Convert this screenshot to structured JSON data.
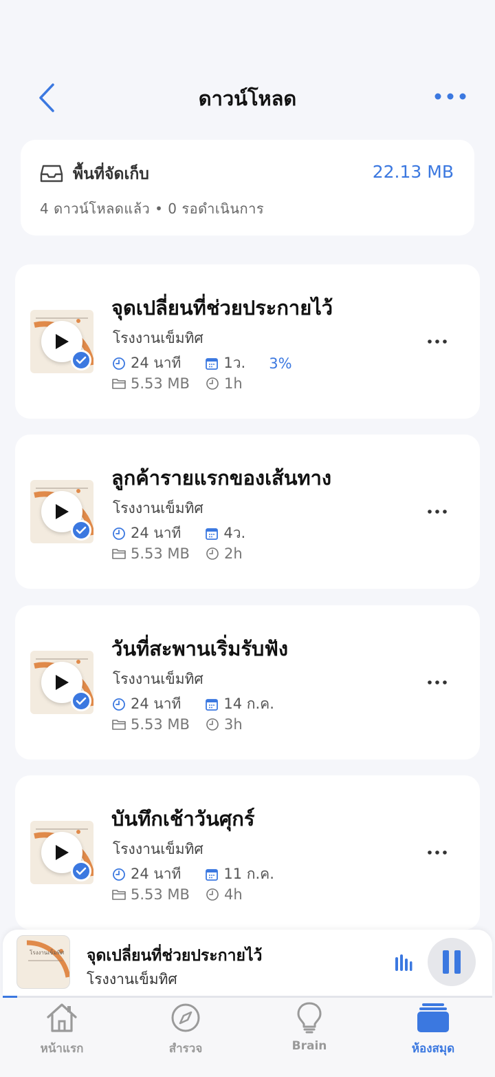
{
  "header": {
    "title": "ดาวน์โหลด"
  },
  "storage": {
    "title": "พื้นที่จัดเก็บ",
    "size": "22.13 MB",
    "summary": "4 ดาวน์โหลดแล้ว • 0 รอดำเนินการ"
  },
  "episodes": [
    {
      "title": "จุดเปลี่ยนที่ช่วยประกายไว้",
      "channel": "โรงงานเข็มทิศ",
      "duration": "24 นาที",
      "date": "1ว.",
      "progress": "3%",
      "size": "5.53 MB",
      "age": "1h"
    },
    {
      "title": "ลูกค้ารายแรกของเส้นทาง",
      "channel": "โรงงานเข็มทิศ",
      "duration": "24 นาที",
      "date": "4ว.",
      "progress": "",
      "size": "5.53 MB",
      "age": "2h"
    },
    {
      "title": "วันที่สะพานเริ่มรับฟัง",
      "channel": "โรงงานเข็มทิศ",
      "duration": "24 นาที",
      "date": "14 ก.ค.",
      "progress": "",
      "size": "5.53 MB",
      "age": "3h"
    },
    {
      "title": "บันทึกเช้าวันศุกร์",
      "channel": "โรงงานเข็มทิศ",
      "duration": "24 นาที",
      "date": "11 ก.ค.",
      "progress": "",
      "size": "5.53 MB",
      "age": "4h"
    }
  ],
  "mini_player": {
    "thumb_text": "โรงงานเข็มทิศ",
    "title": "จุดเปลี่ยนที่ช่วยประกายไว้",
    "channel": "โรงงานเข็มทิศ",
    "progress_fraction": 0.03
  },
  "tabs": [
    {
      "label": "หน้าแรก",
      "icon": "home-icon",
      "active": false
    },
    {
      "label": "สำรวจ",
      "icon": "compass-icon",
      "active": false
    },
    {
      "label": "Brain",
      "icon": "lightbulb-icon",
      "active": false
    },
    {
      "label": "ห้องสมุด",
      "icon": "library-icon",
      "active": true
    }
  ],
  "colors": {
    "accent": "#3b78e0",
    "background": "#f5f6fa",
    "card": "#ffffff"
  }
}
